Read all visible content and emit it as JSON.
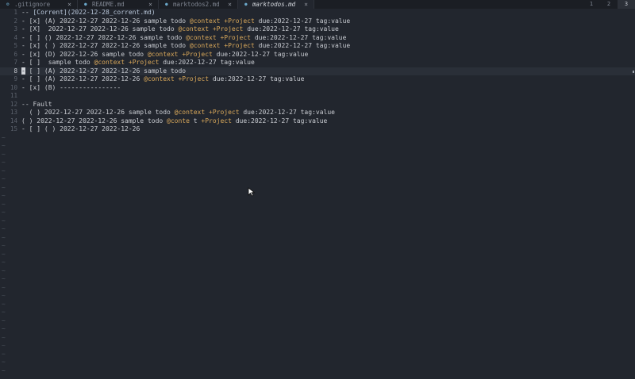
{
  "tabs": [
    {
      "label": ".gitignore",
      "icon": "gear-icon",
      "active": false
    },
    {
      "label": "README.md",
      "icon": "markdown-icon",
      "active": false
    },
    {
      "label": "marktodos2.md",
      "icon": "markdown-icon",
      "active": false
    },
    {
      "label": "marktodos.md",
      "icon": "markdown-icon",
      "active": true
    }
  ],
  "close_glyph": "×",
  "tab_numbers": [
    "1",
    "2",
    "3"
  ],
  "current_tab_number": "3",
  "lines": [
    {
      "n": "1",
      "segs": [
        [
          "t",
          "-- "
        ],
        [
          "l",
          "[Corrent](2022-12-28_corrent.md)"
        ]
      ]
    },
    {
      "n": "2",
      "segs": [
        [
          "t",
          "- [x] (A) 2022-12-27 2022-12-26 sample todo "
        ],
        [
          "c",
          "@context"
        ],
        [
          "t",
          " "
        ],
        [
          "p",
          "+Project"
        ],
        [
          "t",
          " due:2022-12-27 tag:value"
        ]
      ]
    },
    {
      "n": "3",
      "segs": [
        [
          "t",
          "- [X]  2022-12-27 2022-12-26 sample todo "
        ],
        [
          "c",
          "@context"
        ],
        [
          "t",
          " "
        ],
        [
          "p",
          "+Project"
        ],
        [
          "t",
          " due:2022-12-27 tag:value"
        ]
      ]
    },
    {
      "n": "4",
      "segs": [
        [
          "t",
          "- [ ] () 2022-12-27 2022-12-26 sample todo "
        ],
        [
          "c",
          "@context"
        ],
        [
          "t",
          " "
        ],
        [
          "p",
          "+Project"
        ],
        [
          "t",
          " due:2022-12-27 tag:value"
        ]
      ]
    },
    {
      "n": "5",
      "segs": [
        [
          "t",
          "- [x] ( ) 2022-12-27 2022-12-26 sample todo "
        ],
        [
          "c",
          "@context"
        ],
        [
          "t",
          " "
        ],
        [
          "p",
          "+Project"
        ],
        [
          "t",
          " due:2022-12-27 tag:value"
        ]
      ]
    },
    {
      "n": "6",
      "segs": [
        [
          "t",
          "- [x] (D) 2022-12-26 sample todo "
        ],
        [
          "c",
          "@context"
        ],
        [
          "t",
          " "
        ],
        [
          "p",
          "+Project"
        ],
        [
          "t",
          " due:2022-12-27 tag:value"
        ]
      ]
    },
    {
      "n": "7",
      "segs": [
        [
          "t",
          "- [ ]  sample todo "
        ],
        [
          "c",
          "@context"
        ],
        [
          "t",
          " "
        ],
        [
          "p",
          "+Project"
        ],
        [
          "t",
          " due:2022-12-27 tag:value"
        ]
      ]
    },
    {
      "n": "8",
      "current": true,
      "segs": [
        [
          "k",
          "-"
        ],
        [
          "t",
          " [ ] (A) 2022-12-27 2022-12-26 sample todo"
        ]
      ]
    },
    {
      "n": "9",
      "segs": [
        [
          "t",
          "- [ ] (A) 2022-12-27 2022-12-26 "
        ],
        [
          "c",
          "@context"
        ],
        [
          "t",
          " "
        ],
        [
          "p",
          "+Project"
        ],
        [
          "t",
          " due:2022-12-27 tag:value"
        ]
      ]
    },
    {
      "n": "10",
      "segs": [
        [
          "t",
          "- [x] (B) ----------------"
        ]
      ]
    },
    {
      "n": "11",
      "segs": []
    },
    {
      "n": "12",
      "segs": [
        [
          "t",
          "-- Fault"
        ]
      ]
    },
    {
      "n": "13",
      "segs": [
        [
          "t",
          "  ( ) 2022-12-27 2022-12-26 sample todo "
        ],
        [
          "c",
          "@context"
        ],
        [
          "t",
          " "
        ],
        [
          "p",
          "+Project"
        ],
        [
          "t",
          " due:2022-12-27 tag:value"
        ]
      ]
    },
    {
      "n": "14",
      "segs": [
        [
          "t",
          "( ) 2022-12-27 2022-12-26 sample todo "
        ],
        [
          "c",
          "@conte"
        ],
        [
          "t",
          " t "
        ],
        [
          "p",
          "+Project"
        ],
        [
          "t",
          " due:2022-12-27 tag:value"
        ]
      ]
    },
    {
      "n": "15",
      "segs": [
        [
          "t",
          "- [ ] ( ) 2022-12-27 2022-12-26"
        ]
      ]
    }
  ],
  "tilde": "~",
  "colors": {
    "context": "#d9a85a",
    "project": "#d9a85a",
    "background": "#22262e"
  }
}
